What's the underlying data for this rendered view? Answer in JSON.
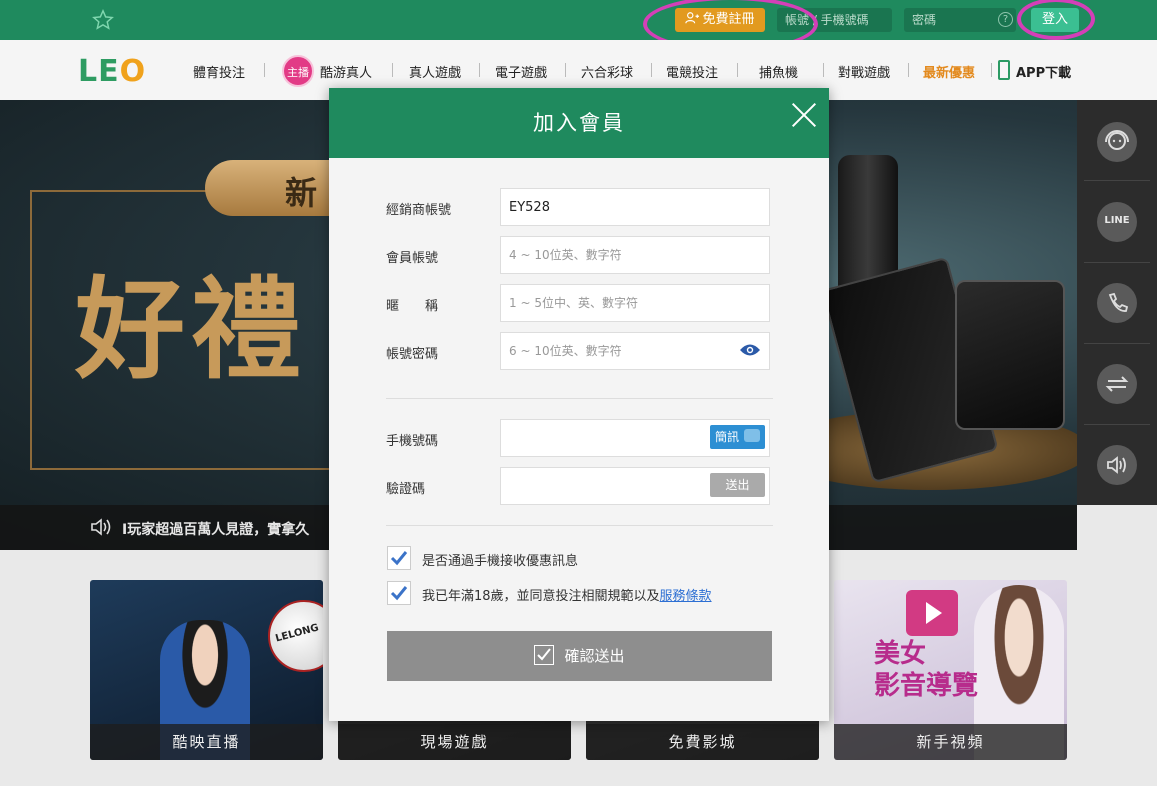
{
  "header": {
    "register_label": "免費註冊",
    "account_placeholder": "帳號 / 手機號碼",
    "password_placeholder": "密碼",
    "help_glyph": "?",
    "login_label": "登入"
  },
  "logo": {
    "l": "L",
    "e": "E",
    "o": "O"
  },
  "nav": {
    "live_badge": "主播",
    "items": [
      "體育投注",
      "酷游真人",
      "真人遊戲",
      "電子遊戲",
      "六合彩球",
      "電競投注",
      "捕魚機",
      "對戰遊戲",
      "最新優惠",
      "APP下載"
    ]
  },
  "banner": {
    "pill_text": "新",
    "headline": "好禮",
    "marquee": "I玩家超過百萬人見證，實拿久"
  },
  "rail": {
    "line_label": "LINE"
  },
  "cards": [
    {
      "caption": "酷映直播",
      "ball_text": "LELONG"
    },
    {
      "caption": "現場遊戲"
    },
    {
      "caption": "免費影城"
    },
    {
      "caption": "新手視頻",
      "title_line1": "美女",
      "title_line2": "影音導覽"
    }
  ],
  "modal": {
    "title": "加入會員",
    "agent_label": "經銷商帳號",
    "agent_value": "EY528",
    "member_label": "會員帳號",
    "member_placeholder": "4 ~ 10位英、數字符",
    "nick_label": "暱　　稱",
    "nick_placeholder": "1 ~ 5位中、英、數字符",
    "password_label": "帳號密碼",
    "password_placeholder": "6 ~ 10位英、數字符",
    "phone_label": "手機號碼",
    "sms_label": "簡訊",
    "code_label": "驗證碼",
    "send_label": "送出",
    "promo_check_label": "是否通過手機接收優惠訊息",
    "age_check_label": "我已年滿18歲，並同意投注相關規範以及",
    "terms_link": "服務條款",
    "submit_label": "確認送出"
  },
  "colors": {
    "brand_green": "#1f8a5e",
    "register_orange": "#e29a1f",
    "login_green": "#3bbf92",
    "annotation_magenta": "#d43fb8",
    "promo_orange": "#e38a1e",
    "sms_blue": "#2d8fd3",
    "check_blue": "#3b73c8"
  }
}
